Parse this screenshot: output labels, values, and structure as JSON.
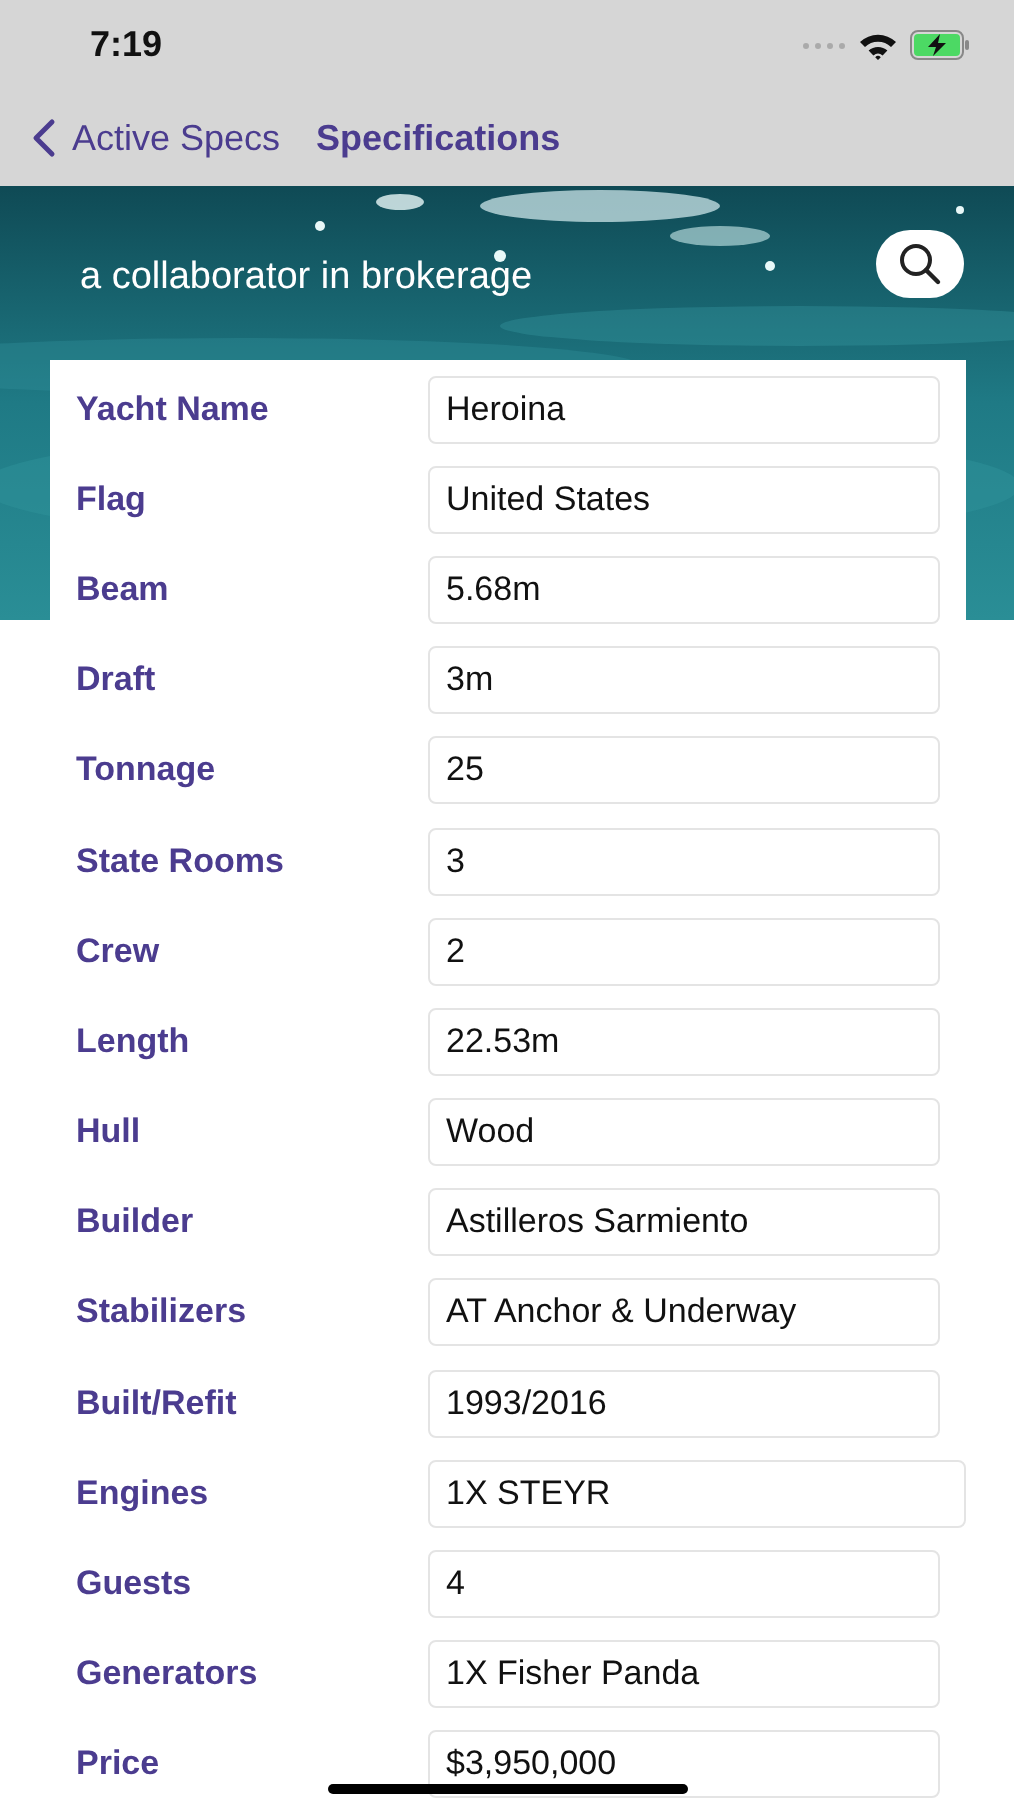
{
  "status_bar": {
    "time": "7:19"
  },
  "nav": {
    "back_label": "Active Specs",
    "title": "Specifications"
  },
  "hero": {
    "kind": "picture",
    "tagline": "a collaborator in brokerage"
  },
  "specs": [
    {
      "label": "Yacht Name",
      "value": "Heroina",
      "wide": false
    },
    {
      "label": "Flag",
      "value": "United States",
      "wide": false
    },
    {
      "label": "Beam",
      "value": "5.68m",
      "wide": false
    },
    {
      "label": "Draft",
      "value": "3m",
      "wide": false
    },
    {
      "label": "Tonnage",
      "value": "25",
      "wide": false
    },
    {
      "label": "State Rooms",
      "value": "3",
      "wide": false
    },
    {
      "label": "Crew",
      "value": "2",
      "wide": false
    },
    {
      "label": "Length",
      "value": "22.53m",
      "wide": false
    },
    {
      "label": "Hull",
      "value": "Wood",
      "wide": false
    },
    {
      "label": "Builder",
      "value": "Astilleros Sarmiento",
      "wide": false
    },
    {
      "label": "Stabilizers",
      "value": "AT Anchor & Underway",
      "wide": false
    },
    {
      "label": "Built/Refit",
      "value": "1993/2016",
      "wide": false
    },
    {
      "label": "Engines",
      "value": "1X STEYR",
      "wide": true
    },
    {
      "label": "Guests",
      "value": "4",
      "wide": false
    },
    {
      "label": "Generators",
      "value": "1X Fisher Panda",
      "wide": false
    },
    {
      "label": "Price",
      "value": "$3,950,000",
      "wide": false
    }
  ]
}
